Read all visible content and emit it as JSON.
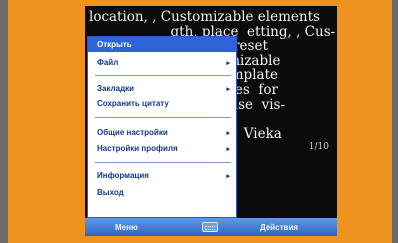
{
  "document": {
    "lines": [
      "location, , Customizable elements",
      "                   gth, place  etting, , Cus-",
      "                         for  preset",
      "                       Customizable",
      "                       nal  template",
      "                       emplates  for",
      "",
      "                       m, please  vis-",
      "                       .com/",
      "                       0-2004  Vieka"
    ],
    "scroll_note": "1/10"
  },
  "menu": {
    "items": [
      {
        "label": "Открыть",
        "submenu": false
      },
      {
        "label": "Файл",
        "submenu": true
      },
      {
        "label": "Закладки",
        "submenu": true
      },
      {
        "label": "Сохранить цитату",
        "submenu": false
      },
      {
        "label": "Общие настройки",
        "submenu": true
      },
      {
        "label": "Настройки профиля",
        "submenu": true
      },
      {
        "label": "Информация",
        "submenu": true
      },
      {
        "label": "Выход",
        "submenu": false
      }
    ]
  },
  "softkeys": {
    "left": "Меню",
    "right": "Действия"
  },
  "icons": {
    "submenu_chevron": "▸",
    "keyboard": "keyboard-icon"
  },
  "colors": {
    "frame": "#f0931e",
    "screen_bg": "#0b0b0b",
    "menu_highlight": "#2e63d8",
    "softbar": "#2f64c2"
  }
}
